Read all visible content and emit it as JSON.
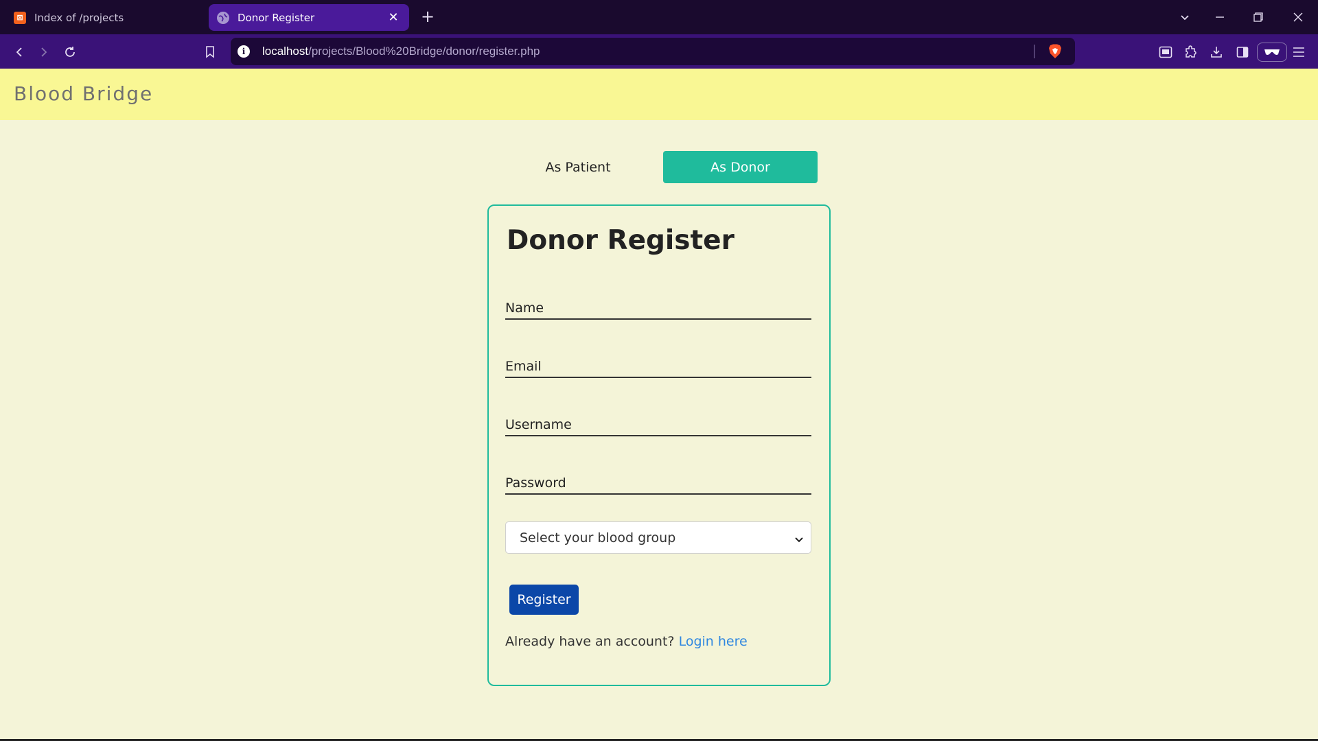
{
  "browser": {
    "tabs": [
      {
        "title": "Index of /projects",
        "icon": "xampp-icon",
        "active": false
      },
      {
        "title": "Donor Register",
        "icon": "globe-icon",
        "active": true
      }
    ],
    "url_host": "localhost",
    "url_path": "/projects/Blood%20Bridge/donor/register.php"
  },
  "navbar": {
    "brand": "Blood Bridge"
  },
  "switcher": {
    "patient_label": "As Patient",
    "donor_label": "As Donor",
    "active": "donor"
  },
  "form": {
    "title": "Donor Register",
    "fields": {
      "name_placeholder": "Name",
      "email_placeholder": "Email",
      "username_placeholder": "Username",
      "password_placeholder": "Password"
    },
    "blood_group_select": "Select your blood group",
    "submit_label": "Register",
    "login_prompt": "Already have an account?",
    "login_link": "Login here"
  },
  "colors": {
    "page_bg": "#f4f4d8",
    "navbar_bg": "#f9f794",
    "accent": "#1fbb9c",
    "primary_button": "#0b47a8",
    "link": "#2f87e0"
  }
}
